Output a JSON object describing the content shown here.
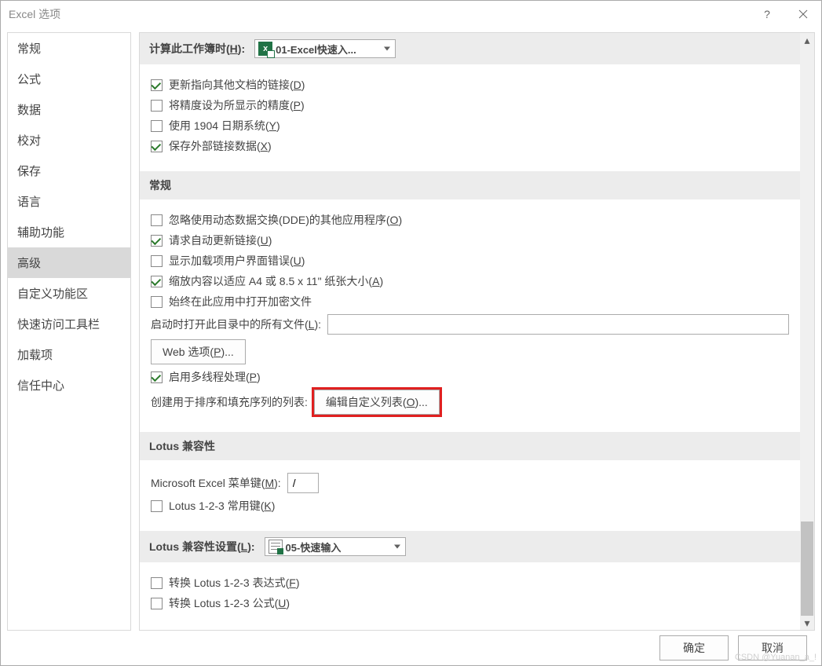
{
  "window": {
    "title": "Excel 选项"
  },
  "sidebar": {
    "items": [
      {
        "label": "常规"
      },
      {
        "label": "公式"
      },
      {
        "label": "数据"
      },
      {
        "label": "校对"
      },
      {
        "label": "保存"
      },
      {
        "label": "语言"
      },
      {
        "label": "辅助功能"
      },
      {
        "label": "高级",
        "selected": true
      },
      {
        "label": "自定义功能区"
      },
      {
        "label": "快速访问工具栏"
      },
      {
        "label": "加载项"
      },
      {
        "label": "信任中心"
      }
    ]
  },
  "workbook_calc": {
    "header_label": "计算此工作簿时(",
    "header_key": "H",
    "header_tail": "):",
    "combo_value": "01-Excel快速入...",
    "opt_update_links": {
      "label": "更新指向其他文档的链接(",
      "key": "D",
      "tail": ")",
      "checked": true
    },
    "opt_precision": {
      "label": "将精度设为所显示的精度(",
      "key": "P",
      "tail": ")",
      "checked": false
    },
    "opt_1904": {
      "label": "使用 1904 日期系统(",
      "key": "Y",
      "tail": ")",
      "checked": false
    },
    "opt_save_ext": {
      "label": "保存外部链接数据(",
      "key": "X",
      "tail": ")",
      "checked": true
    }
  },
  "general": {
    "header": "常规",
    "opt_dde": {
      "label": "忽略使用动态数据交换(DDE)的其他应用程序(",
      "key": "O",
      "tail": ")",
      "checked": false
    },
    "opt_ask_upd": {
      "label": "请求自动更新链接(",
      "key": "U",
      "tail": ")",
      "checked": true
    },
    "opt_addin_err": {
      "label": "显示加载项用户界面错误(",
      "key": "U",
      "tail": ")",
      "checked": false
    },
    "opt_scale": {
      "label": "缩放内容以适应 A4 或 8.5 x 11\" 纸张大小(",
      "key": "A",
      "tail": ")",
      "checked": true
    },
    "opt_encrypt": {
      "label": "始终在此应用中打开加密文件",
      "checked": false
    },
    "startup_label": "启动时打开此目录中的所有文件(",
    "startup_key": "L",
    "startup_tail": "):",
    "startup_value": "",
    "web_options_label": "Web 选项(",
    "web_options_key": "P",
    "web_options_tail": ")...",
    "opt_multithread": {
      "label": "启用多线程处理(",
      "key": "P",
      "tail": ")",
      "checked": true
    },
    "custom_list_prefix": "创建用于排序和填充序列的列表:",
    "custom_list_btn": "编辑自定义列表(",
    "custom_list_key": "O",
    "custom_list_tail": ")..."
  },
  "lotus_compat": {
    "header": "Lotus 兼容性",
    "menu_key_label": "Microsoft Excel 菜单键(",
    "menu_key_key": "M",
    "menu_key_tail": "):",
    "menu_key_value": "/",
    "opt_lotus_keys": {
      "label": "Lotus 1-2-3 常用键(",
      "key": "K",
      "tail": ")",
      "checked": false
    }
  },
  "lotus_settings": {
    "header_label": "Lotus 兼容性设置(",
    "header_key": "L",
    "header_tail": "):",
    "combo_value": "05-快速输入",
    "opt_expr": {
      "label": "转换 Lotus 1-2-3 表达式(",
      "key": "F",
      "tail": ")",
      "checked": false
    },
    "opt_formula": {
      "label": "转换 Lotus 1-2-3 公式(",
      "key": "U",
      "tail": ")",
      "checked": false
    }
  },
  "footer": {
    "ok": "确定",
    "cancel": "取消"
  },
  "watermark": "CSDN @Yuanan_a_!"
}
